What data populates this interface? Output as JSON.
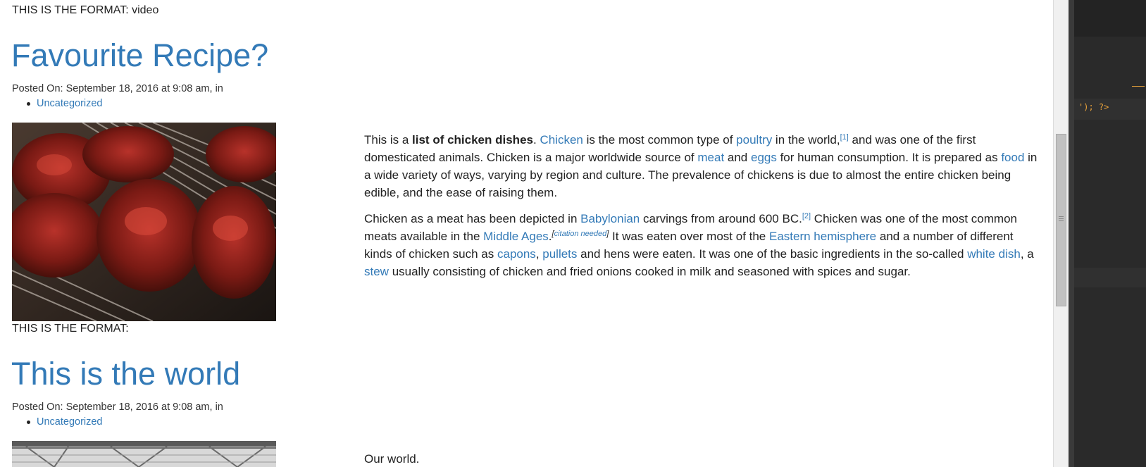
{
  "posts": [
    {
      "format_line": "THIS IS THE FORMAT: video",
      "title": "Favourite Recipe?",
      "posted_on": "Posted On: September 18, 2016 at 9:08 am, in",
      "category": "Uncategorized",
      "image_alt": "grilled barbecue chicken"
    },
    {
      "format_line": "THIS IS THE FORMAT:",
      "title": "This is the world",
      "posted_on": "Posted On: September 18, 2016 at 9:08 am, in",
      "category": "Uncategorized",
      "image_alt": "warehouse roof structure",
      "content": "Our world."
    }
  ],
  "article": {
    "p1": {
      "t1": "This is a ",
      "bold": "list of chicken dishes",
      "t2": ". ",
      "l_chicken": "Chicken",
      "t3": " is the most common type of ",
      "l_poultry": "poultry",
      "t4": " in the world,",
      "ref1": "[1]",
      "t5": " and was one of the first domesticated animals. Chicken is a major worldwide source of ",
      "l_meat": "meat",
      "t6": " and ",
      "l_eggs": "eggs",
      "t7": " for human consumption. It is prepared as ",
      "l_food": "food",
      "t8": " in a wide variety of ways, varying by region and culture. The prevalence of chickens is due to almost the entire chicken being edible, and the ease of raising them."
    },
    "p2": {
      "t1": "Chicken as a meat has been depicted in ",
      "l_babylonian": "Babylonian",
      "t2": " carvings from around 600 BC.",
      "ref2": "[2]",
      "t3": " Chicken was one of the most common meats available in the ",
      "l_middle_ages": "Middle Ages",
      "t4": ".",
      "cite_open": "[",
      "cite": "citation needed",
      "cite_close": "]",
      "t5": " It was eaten over most of the ",
      "l_eastern": "Eastern hemisphere",
      "t6": " and a number of different kinds of chicken such as ",
      "l_capons": "capons",
      "t7": ", ",
      "l_pullets": "pullets",
      "t8": " and hens were eaten. It was one of the basic ingredients in the so-called ",
      "l_white_dish": "white dish",
      "t9": ", a ",
      "l_stew": "stew",
      "t10": " usually consisting of chicken and fried onions cooked in milk and seasoned with spices and sugar."
    }
  },
  "editor": {
    "code_fragment": "'); ?>"
  },
  "colors": {
    "link": "#337ab7",
    "text": "#222222",
    "editor_bg": "#2a2a2a",
    "editor_accent": "#e8a13a"
  }
}
